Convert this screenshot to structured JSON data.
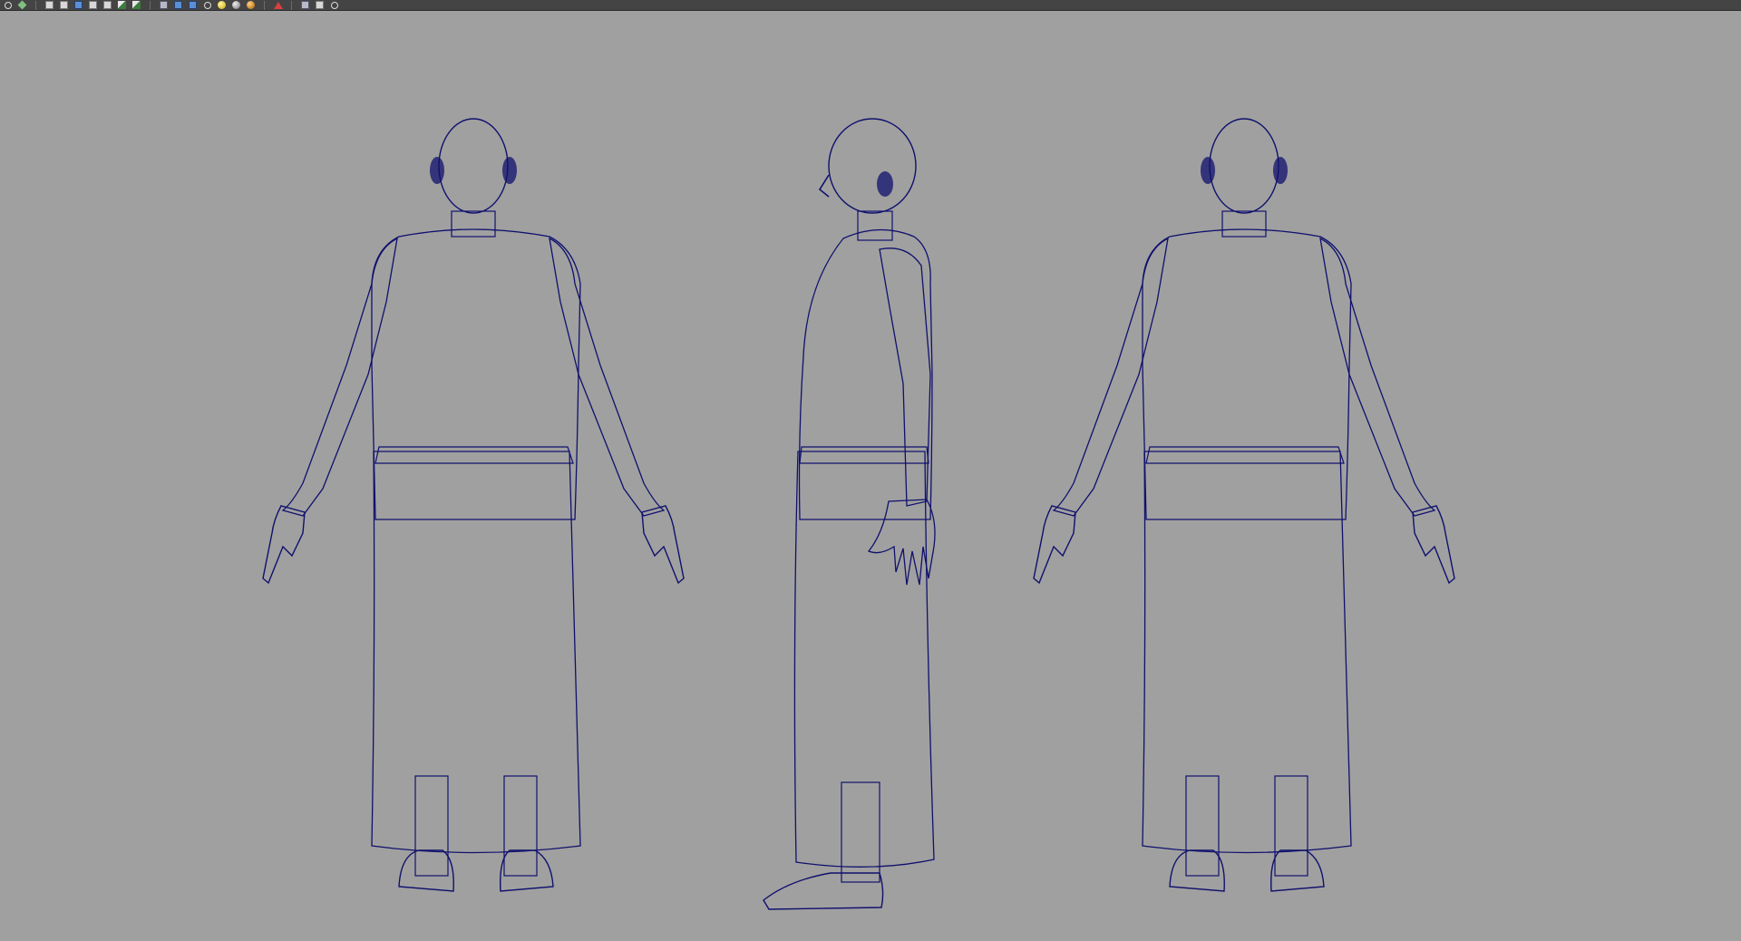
{
  "toolbar": {
    "buttons": [
      {
        "name": "snap-icon",
        "kind": "ring"
      },
      {
        "name": "paint-select-icon",
        "kind": "diamond"
      },
      {
        "name": "render-view-icon",
        "kind": "doc"
      },
      {
        "name": "render-frame-icon",
        "kind": "doc"
      },
      {
        "name": "ipr-render-icon",
        "kind": "box"
      },
      {
        "name": "render-settings-icon",
        "kind": "doc"
      },
      {
        "name": "hypershade-icon",
        "kind": "doc"
      },
      {
        "name": "grid-toggle-icon",
        "kind": "key"
      },
      {
        "name": "attribute-icon",
        "kind": "key"
      },
      {
        "name": "wireframe-shade-icon",
        "kind": "cube"
      },
      {
        "name": "smooth-shade-icon",
        "kind": "box"
      },
      {
        "name": "textured-icon",
        "kind": "box"
      },
      {
        "name": "lights-icon",
        "kind": "ring"
      },
      {
        "name": "default-light-icon",
        "kind": "sphere-yellow"
      },
      {
        "name": "all-lights-icon",
        "kind": "sphere-gray"
      },
      {
        "name": "shadows-icon",
        "kind": "sphere-orange"
      },
      {
        "name": "isolate-select-icon",
        "kind": "arrow"
      },
      {
        "name": "xray-icon",
        "kind": "cube"
      },
      {
        "name": "camera-attributes-icon",
        "kind": "doc"
      },
      {
        "name": "bookmark-icon",
        "kind": "ring"
      }
    ],
    "separators_after": [
      1,
      8,
      15,
      16
    ]
  },
  "viewport": {
    "background_color": "#a0a0a0",
    "wireframe_color": "#10106e",
    "views": [
      {
        "name": "front-view-model"
      },
      {
        "name": "side-view-model"
      },
      {
        "name": "back-view-model"
      }
    ]
  }
}
